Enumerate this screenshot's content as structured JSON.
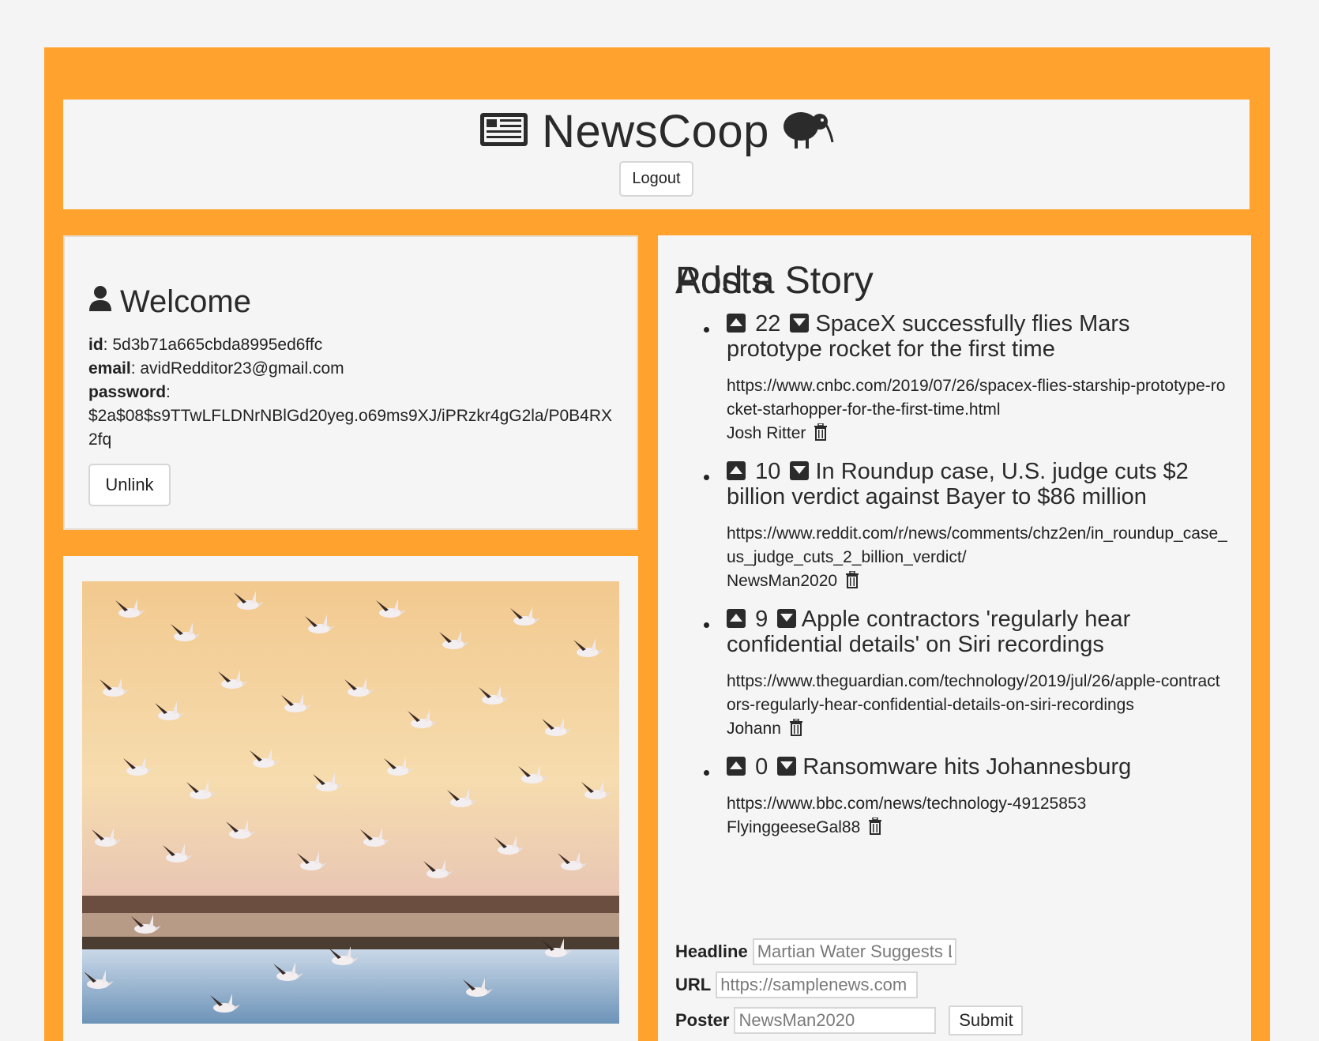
{
  "header": {
    "title": "NewsCoop",
    "logout_label": "Logout"
  },
  "welcome": {
    "title": "Welcome",
    "id_label": "id",
    "id_value": "5d3b71a665cbda8995ed6ffc",
    "email_label": "email",
    "email_value": "avidRedditor23@gmail.com",
    "password_label": "password",
    "password_value": "$2a$08$s9TTwLFLDNrNBlGd20yeg.o69ms9XJ/iPRzkr4gG2la/P0B4RX2fq",
    "unlink_label": "Unlink"
  },
  "posts": {
    "title": "Posts",
    "items": [
      {
        "score": "22",
        "headline": "SpaceX successfully flies Mars prototype rocket for the first time",
        "url": "https://www.cnbc.com/2019/07/26/spacex-flies-starship-prototype-rocket-starhopper-for-the-first-time.html",
        "author": "Josh Ritter"
      },
      {
        "score": "10",
        "headline": "In Roundup case, U.S. judge cuts $2 billion verdict against Bayer to $86 million",
        "url": "https://www.reddit.com/r/news/comments/chz2en/in_roundup_case_us_judge_cuts_2_billion_verdict/",
        "author": "NewsMan2020"
      },
      {
        "score": "9",
        "headline": "Apple contractors 'regularly hear confidential details' on Siri recordings",
        "url": "https://www.theguardian.com/technology/2019/jul/26/apple-contractors-regularly-hear-confidential-details-on-siri-recordings",
        "author": "Johann"
      },
      {
        "score": "0",
        "headline": "Ransomware hits Johannesburg",
        "url": "https://www.bbc.com/news/technology-49125853",
        "author": "FlyinggeeseGal88"
      }
    ]
  },
  "add_story": {
    "title": "Add a Story",
    "headline_label": "Headline",
    "headline_placeholder": "Martian Water Suggests L",
    "url_label": "URL",
    "url_placeholder": "https://samplenews.com",
    "poster_label": "Poster",
    "poster_placeholder": "NewsMan2020",
    "submit_label": "Submit"
  },
  "icons": {
    "newspaper": "newspaper-icon",
    "kiwi": "kiwi-bird-icon",
    "user": "user-icon",
    "upvote": "caret-up-icon",
    "downvote": "caret-down-icon",
    "trash": "trash-icon"
  },
  "colors": {
    "frame": "#ffa32e",
    "panel": "#f5f5f5"
  }
}
